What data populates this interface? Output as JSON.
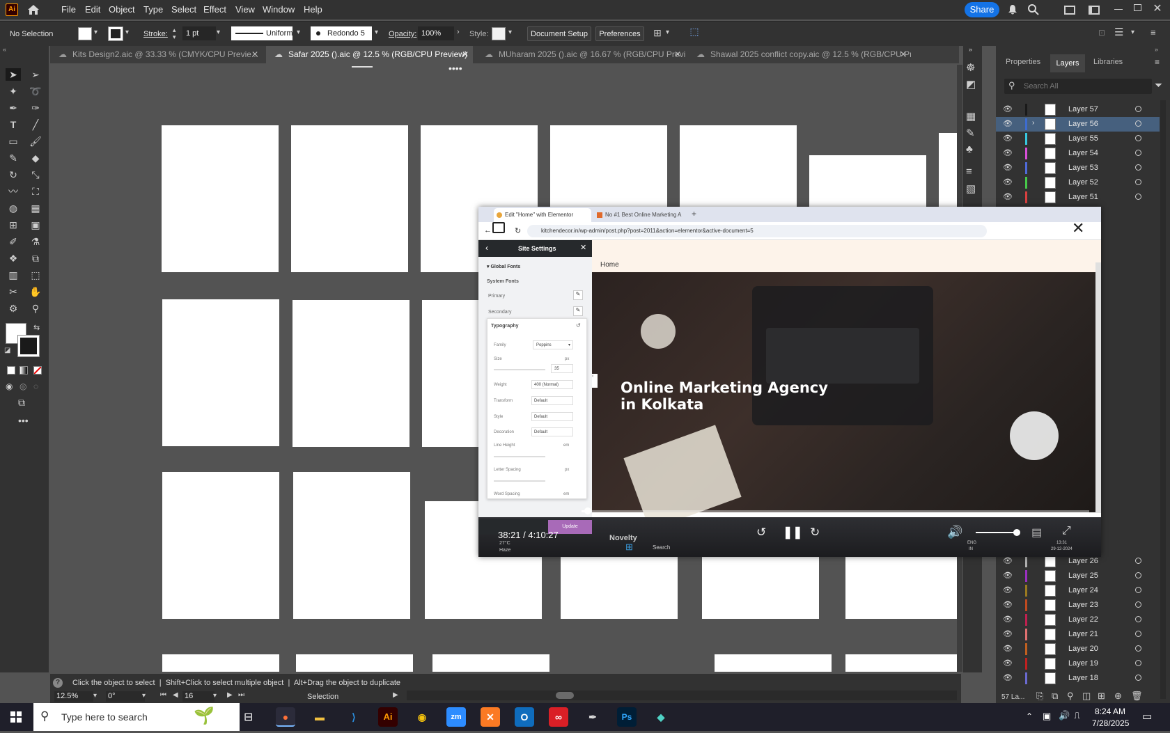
{
  "menubar": {
    "app_logo": "Ai",
    "items": [
      "File",
      "Edit",
      "Object",
      "Type",
      "Select",
      "Effect",
      "View",
      "Window",
      "Help"
    ],
    "share_label": "Share"
  },
  "control_bar": {
    "selection": "No Selection",
    "stroke_label": "Stroke:",
    "stroke_value": "1 pt",
    "profile": "Uniform",
    "brush": "Redondo 5 ...",
    "opacity_label": "Opacity:",
    "opacity_value": "100%",
    "style_label": "Style:",
    "document_setup": "Document Setup",
    "preferences": "Preferences"
  },
  "tabs": [
    {
      "label": "Kits Design2.aic @ 33.33 % (CMYK/CPU Previe...",
      "active": false
    },
    {
      "label": "Safar 2025 ().aic @ 12.5 % (RGB/CPU Preview)",
      "active": true
    },
    {
      "label": "MUharam 2025 ().aic @ 16.67 % (RGB/CPU Previe...",
      "active": false
    },
    {
      "label": "Shawal 2025 conflict copy.aic @ 12.5 % (RGB/CPU Prev...",
      "active": false
    }
  ],
  "panel": {
    "tabs": [
      "Properties",
      "Layers",
      "Libraries"
    ],
    "active_tab": "Layers",
    "search_placeholder": "Search All",
    "layers_top": [
      {
        "name": "Layer 57",
        "color": "#1a1a1a",
        "selected": false
      },
      {
        "name": "Layer 56",
        "color": "#3d6ccf",
        "selected": true
      },
      {
        "name": "Layer 55",
        "color": "#37c8e0",
        "selected": false
      },
      {
        "name": "Layer 54",
        "color": "#d94fd9",
        "selected": false
      },
      {
        "name": "Layer 53",
        "color": "#4f6ad9",
        "selected": false
      },
      {
        "name": "Layer 52",
        "color": "#47c94a",
        "selected": false
      },
      {
        "name": "Layer 51",
        "color": "#d94040",
        "selected": false
      }
    ],
    "layers_bottom": [
      {
        "name": "Layer 26",
        "color": "#b0b0b0"
      },
      {
        "name": "Layer 25",
        "color": "#9a2fc0"
      },
      {
        "name": "Layer 24",
        "color": "#9a7a20"
      },
      {
        "name": "Layer 23",
        "color": "#c04a20"
      },
      {
        "name": "Layer 22",
        "color": "#c02050"
      },
      {
        "name": "Layer 21",
        "color": "#e07070"
      },
      {
        "name": "Layer 20",
        "color": "#c06020"
      },
      {
        "name": "Layer 19",
        "color": "#c02020"
      },
      {
        "name": "Layer 18",
        "color": "#6a6ad0"
      }
    ],
    "layer_count": "57 La..."
  },
  "status": {
    "hint": "Click the object to select  |  Shift+Click to select multiple object  |  Alt+Drag the object to duplicate",
    "zoom": "12.5%",
    "rotation": "0°",
    "artboard": "16",
    "tool": "Selection"
  },
  "video": {
    "browser_tab1": "Edit \"Home\" with Elementor",
    "browser_tab2": "No #1 Best Online Marketing A",
    "url": "kitchendecor.in/wp-admin/post.php?post=2011&action=elementor&active-document=5",
    "site_settings": "Site Settings",
    "global_fonts": "Global Fonts",
    "system_fonts": "System Fonts",
    "primary": "Primary",
    "secondary": "Secondary",
    "typography": "Typography",
    "family_label": "Family",
    "family_value": "Poppins",
    "size_label": "Size",
    "size_unit": "px",
    "size_value": "35",
    "weight_label": "Weight",
    "weight_value": "400 (Normal)",
    "transform_label": "Transform",
    "style_label": "Style",
    "decoration_label": "Decoration",
    "default_value": "Default",
    "line_height": "Line Height",
    "letter_spacing": "Letter Spacing",
    "word_spacing": "Word Spacing",
    "em_unit": "em",
    "update": "Update",
    "nav_home": "Home",
    "hero": "Online Marketing Agency in Kolkata",
    "time": "38:21 / 4:10:27",
    "inner_search": "Search",
    "inner_weather1": "27°C",
    "inner_weather2": "Haze",
    "inner_clock": "13:31",
    "inner_date": "29-12-2024",
    "inner_lang1": "ENG",
    "inner_lang2": "IN",
    "partial_heading": "Novelty"
  },
  "taskbar": {
    "search_placeholder": "Type here to search",
    "time": "8:24 AM",
    "date": "7/28/2025"
  }
}
